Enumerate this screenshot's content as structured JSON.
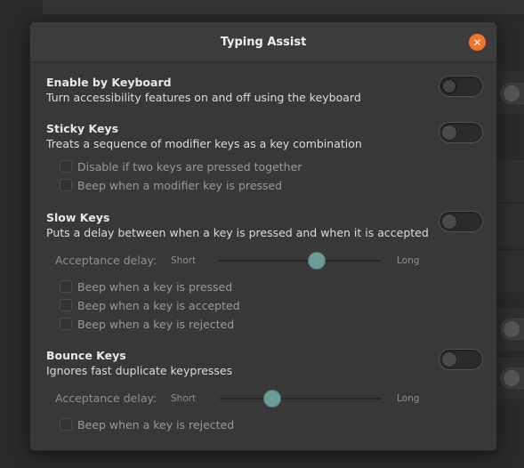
{
  "dialog": {
    "title": "Typing Assist",
    "close_icon": "close-icon"
  },
  "enable_by_keyboard": {
    "title": "Enable by Keyboard",
    "description": "Turn accessibility features on and off using the keyboard",
    "enabled": false
  },
  "sticky_keys": {
    "title": "Sticky Keys",
    "description": "Treats a sequence of modifier keys as a key combination",
    "enabled": false,
    "options": [
      {
        "label": "Disable if two keys are pressed together",
        "checked": false
      },
      {
        "label": "Beep when a modifier key is pressed",
        "checked": false
      }
    ]
  },
  "slow_keys": {
    "title": "Slow Keys",
    "description": "Puts a delay between when a key is pressed and when it is accepted",
    "enabled": false,
    "delay_label": "Acceptance delay:",
    "scale_min": "Short",
    "scale_max": "Long",
    "delay_value": 0.6,
    "options": [
      {
        "label": "Beep when a key is pressed",
        "checked": false
      },
      {
        "label": "Beep when a key is accepted",
        "checked": false
      },
      {
        "label": "Beep when a key is rejected",
        "checked": false
      }
    ]
  },
  "bounce_keys": {
    "title": "Bounce Keys",
    "description": "Ignores fast duplicate keypresses",
    "enabled": false,
    "delay_label": "Acceptance delay:",
    "scale_min": "Short",
    "scale_max": "Long",
    "delay_value": 0.33,
    "options": [
      {
        "label": "Beep when a key is rejected",
        "checked": false
      }
    ]
  },
  "colors": {
    "accent_close": "#f37329",
    "slider_thumb": "#6c9d98",
    "dialog_bg": "#383838"
  }
}
